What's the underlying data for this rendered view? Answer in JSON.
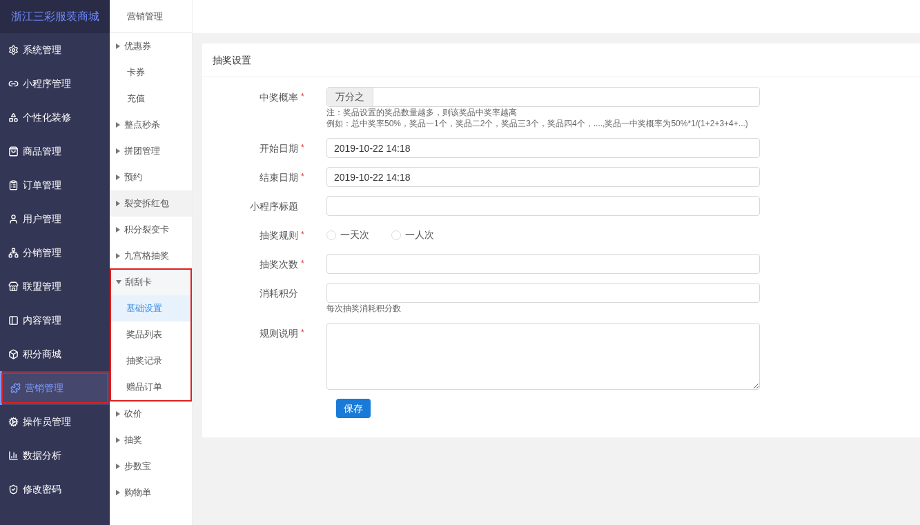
{
  "brand": "浙江三彩服装商城",
  "nav": [
    {
      "label": "系统管理",
      "selected": false,
      "annotated": false
    },
    {
      "label": "小程序管理",
      "selected": false,
      "annotated": false
    },
    {
      "label": "个性化装修",
      "selected": false,
      "annotated": false
    },
    {
      "label": "商品管理",
      "selected": false,
      "annotated": false
    },
    {
      "label": "订单管理",
      "selected": false,
      "annotated": false
    },
    {
      "label": "用户管理",
      "selected": false,
      "annotated": false
    },
    {
      "label": "分销管理",
      "selected": false,
      "annotated": false
    },
    {
      "label": "联盟管理",
      "selected": false,
      "annotated": false
    },
    {
      "label": "内容管理",
      "selected": false,
      "annotated": false
    },
    {
      "label": "积分商城",
      "selected": false,
      "annotated": false
    },
    {
      "label": "营销管理",
      "selected": true,
      "annotated": true
    },
    {
      "label": "操作员管理",
      "selected": false,
      "annotated": false
    },
    {
      "label": "数据分析",
      "selected": false,
      "annotated": false
    },
    {
      "label": "修改密码",
      "selected": false,
      "annotated": false
    }
  ],
  "submenu": {
    "title": "营销管理",
    "items": [
      {
        "label": "优惠券",
        "kind": "group",
        "expanded": false,
        "hovered": false,
        "annotated": false
      },
      {
        "label": "卡券",
        "kind": "link",
        "selected": false
      },
      {
        "label": "充值",
        "kind": "link",
        "selected": false
      },
      {
        "label": "整点秒杀",
        "kind": "group",
        "expanded": false,
        "hovered": false,
        "annotated": false
      },
      {
        "label": "拼团管理",
        "kind": "group",
        "expanded": false,
        "hovered": false,
        "annotated": false
      },
      {
        "label": "预约",
        "kind": "group",
        "expanded": false,
        "hovered": false,
        "annotated": false
      },
      {
        "label": "裂变拆红包",
        "kind": "group",
        "expanded": false,
        "hovered": true,
        "annotated": false
      },
      {
        "label": "积分裂变卡",
        "kind": "group",
        "expanded": false,
        "hovered": false,
        "annotated": false
      },
      {
        "label": "九宫格抽奖",
        "kind": "group",
        "expanded": false,
        "hovered": false,
        "annotated": false
      },
      {
        "label": "刮刮卡",
        "kind": "group",
        "expanded": true,
        "hovered": false,
        "annotated": true,
        "children": [
          {
            "label": "基础设置",
            "selected": true
          },
          {
            "label": "奖品列表",
            "selected": false
          },
          {
            "label": "抽奖记录",
            "selected": false
          },
          {
            "label": "赠品订单",
            "selected": false
          }
        ]
      },
      {
        "label": "砍价",
        "kind": "group",
        "expanded": false,
        "hovered": false,
        "annotated": false
      },
      {
        "label": "抽奖",
        "kind": "group",
        "expanded": false,
        "hovered": false,
        "annotated": false
      },
      {
        "label": "步数宝",
        "kind": "group",
        "expanded": false,
        "hovered": false,
        "annotated": false
      },
      {
        "label": "购物单",
        "kind": "group",
        "expanded": false,
        "hovered": false,
        "annotated": false
      }
    ]
  },
  "form": {
    "title": "抽奖设置",
    "fields": [
      {
        "kind": "addon_input",
        "label": "中奖概率",
        "required": true,
        "addon": "万分之",
        "hints": [
          "注：奖品设置的奖品数量越多，则该奖品中奖率越高",
          "例如：总中奖率50%，奖品一1个，奖品二2个，奖品三3个，奖品四4个，....,奖品一中奖概率为50%*1/(1+2+3+4+...)"
        ]
      },
      {
        "kind": "input",
        "label": "开始日期",
        "required": true,
        "value": "2019-10-22 14:18"
      },
      {
        "kind": "input",
        "label": "结束日期",
        "required": true,
        "value": "2019-10-22 14:18"
      },
      {
        "kind": "input",
        "label": "小程序标题",
        "required": false
      },
      {
        "kind": "radio",
        "label": "抽奖规则",
        "required": true,
        "options": [
          {
            "label": "一天次",
            "selected": false
          },
          {
            "label": "一人次",
            "selected": false
          }
        ]
      },
      {
        "kind": "input",
        "label": "抽奖次数",
        "required": true
      },
      {
        "kind": "input",
        "label": "消耗积分",
        "required": false,
        "hints": [
          "每次抽奖消耗积分数"
        ]
      },
      {
        "kind": "textarea",
        "label": "规则说明",
        "required": true
      }
    ],
    "required_mark": "*",
    "submit": "保存"
  }
}
